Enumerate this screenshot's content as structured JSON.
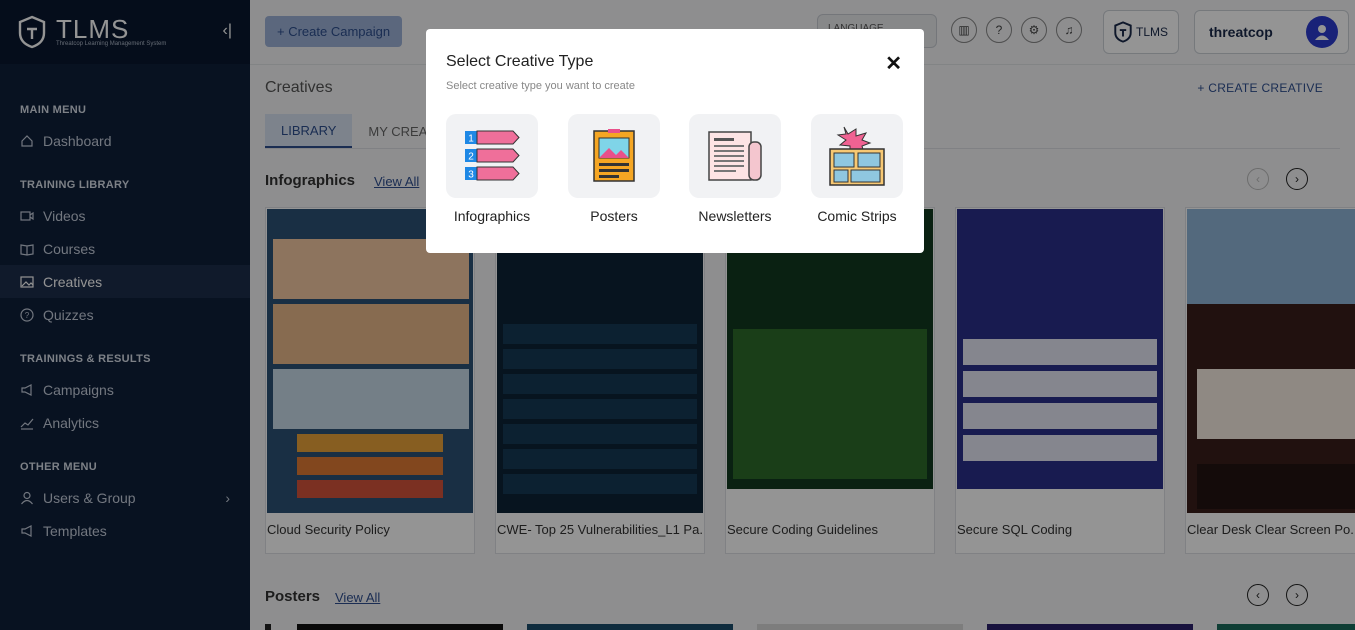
{
  "brand": {
    "name": "TLMS",
    "tagline": "Threatcop Learning Management System"
  },
  "sidebar": {
    "sections": [
      {
        "label": "MAIN MENU",
        "items": [
          {
            "label": "Dashboard",
            "icon": "home-icon"
          }
        ]
      },
      {
        "label": "TRAINING LIBRARY",
        "items": [
          {
            "label": "Videos",
            "icon": "video-icon"
          },
          {
            "label": "Courses",
            "icon": "book-icon"
          },
          {
            "label": "Creatives",
            "icon": "image-icon",
            "active": true
          },
          {
            "label": "Quizzes",
            "icon": "question-icon"
          }
        ]
      },
      {
        "label": "TRAININGS & RESULTS",
        "items": [
          {
            "label": "Campaigns",
            "icon": "megaphone-icon"
          },
          {
            "label": "Analytics",
            "icon": "chart-icon"
          }
        ]
      },
      {
        "label": "OTHER MENU",
        "items": [
          {
            "label": "Users & Group",
            "icon": "user-icon"
          },
          {
            "label": "Templates",
            "icon": "template-icon"
          }
        ]
      }
    ]
  },
  "topbar": {
    "create_campaign": "+ Create Campaign",
    "language": "LANGUAGE",
    "tlms_label": "TLMS",
    "threatcop_label": "threatcop"
  },
  "page": {
    "title": "Creatives",
    "create_creative": "+ CREATE CREATIVE",
    "tabs": [
      "LIBRARY",
      "MY CREATIVES"
    ]
  },
  "infographics": {
    "title": "Infographics",
    "view_all": "View All",
    "cards": [
      {
        "label": "Cloud Security Policy"
      },
      {
        "label": "CWE- Top 25 Vulnerabilities_L1 Pa..."
      },
      {
        "label": "Secure Coding Guidelines"
      },
      {
        "label": "Secure SQL Coding"
      },
      {
        "label": "Clear Desk Clear Screen Po..."
      }
    ]
  },
  "posters": {
    "title": "Posters",
    "view_all": "View All"
  },
  "modal": {
    "title": "Select Creative Type",
    "subtitle": "Select creative type you want to create",
    "options": [
      "Infographics",
      "Posters",
      "Newsletters",
      "Comic Strips"
    ]
  }
}
